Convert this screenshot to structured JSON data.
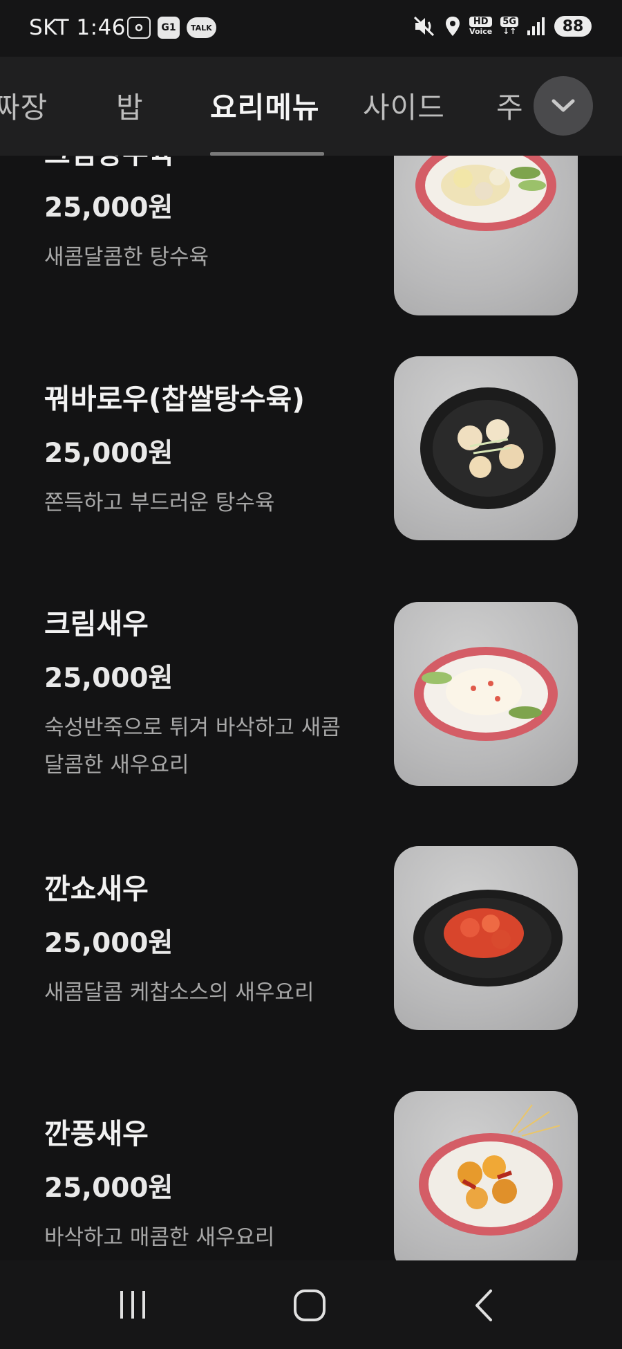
{
  "status_bar": {
    "time": "SKT 1:46",
    "icons_left": [
      "screenshot-icon",
      "g1-app-icon",
      "kakaotalk-icon"
    ],
    "talk_label": "TALK",
    "g1_label": "G1",
    "icons_right": [
      "mute-vibrate-icon",
      "location-icon",
      "hd-voice-icon",
      "5g-icon",
      "signal-icon"
    ],
    "hd_label": "HD",
    "voice_label": "Voice",
    "fiveg_label": "5G",
    "battery": "88"
  },
  "tabs": [
    {
      "label": "짜장",
      "active": false
    },
    {
      "label": "밥",
      "active": false
    },
    {
      "label": "요리메뉴",
      "active": true
    },
    {
      "label": "사이드",
      "active": false
    },
    {
      "label": "주",
      "active": false
    }
  ],
  "menu_items": [
    {
      "name": "크림탕수육",
      "price": "25,000원",
      "desc": "새콤달콤한 탕수육",
      "plate": "red"
    },
    {
      "name": "꿔바로우(찹쌀탕수육)",
      "price": "25,000원",
      "desc": "쫀득하고 부드러운 탕수육",
      "plate": "black"
    },
    {
      "name": "크림새우",
      "price": "25,000원",
      "desc": "숙성반죽으로 튀겨 바삭하고 새콤달콤한 새우요리",
      "plate": "red"
    },
    {
      "name": "깐쇼새우",
      "price": "25,000원",
      "desc": "새콤달콤 케찹소스의 새우요리",
      "plate": "black"
    },
    {
      "name": "깐풍새우",
      "price": "25,000원",
      "desc": "바삭하고 매콤한 새우요리",
      "plate": "red"
    }
  ],
  "nav": {
    "recents": "recents-icon",
    "home": "home-icon",
    "back": "back-icon"
  }
}
